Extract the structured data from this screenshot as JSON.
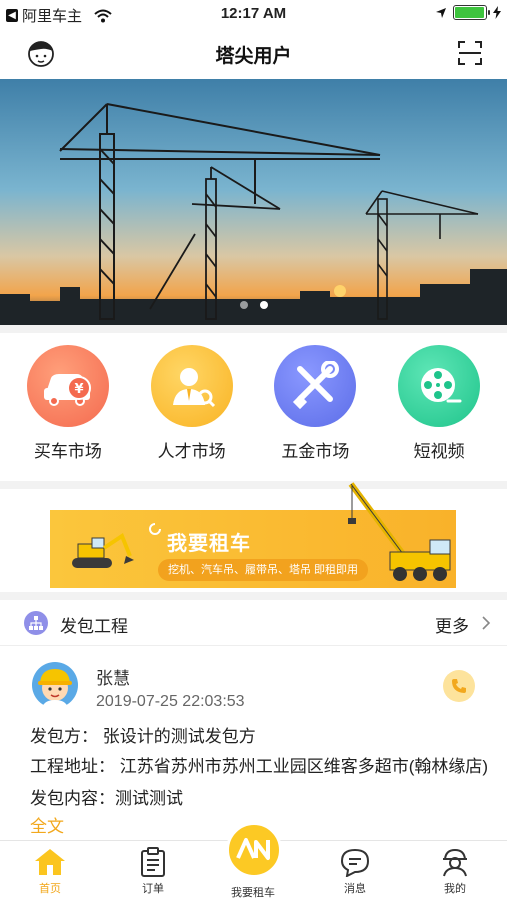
{
  "status_bar": {
    "back_app": "阿里车主",
    "time": "12:17 AM",
    "battery_level": 0.95
  },
  "nav": {
    "title": "塔尖用户",
    "avatar_icon": "user-face-icon",
    "scan_icon": "scan-icon"
  },
  "banner": {
    "slides": 2,
    "active_slide": 2
  },
  "categories": [
    {
      "label": "买车市场",
      "icon": "car-price-icon",
      "color": "#f7735a"
    },
    {
      "label": "人才市场",
      "icon": "talent-person-icon",
      "color": "#fbbd2e"
    },
    {
      "label": "五金市场",
      "icon": "tools-icon",
      "color": "#6b7df0"
    },
    {
      "label": "短视频",
      "icon": "film-reel-icon",
      "color": "#2fcf9b"
    }
  ],
  "promo": {
    "title": "我要租车",
    "subtitle": "挖机、汽车吊、履带吊、塔吊 即租即用"
  },
  "section": {
    "title": "发包工程",
    "more": "更多",
    "icon": "sitemap-icon"
  },
  "card": {
    "name": "张慧",
    "time": "2019-07-25 22:03:53",
    "contractor": "发包方：  张设计的测试发包方",
    "address": "工程地址：  江苏省苏州市苏州工业园区维客多超市(翰林缘店)",
    "content": "发包内容：测试测试",
    "more": "全文"
  },
  "tabbar": {
    "home": "首页",
    "orders": "订单",
    "rent": "我要租车",
    "messages": "消息",
    "mine": "我的",
    "accent": "#f2a81d"
  }
}
